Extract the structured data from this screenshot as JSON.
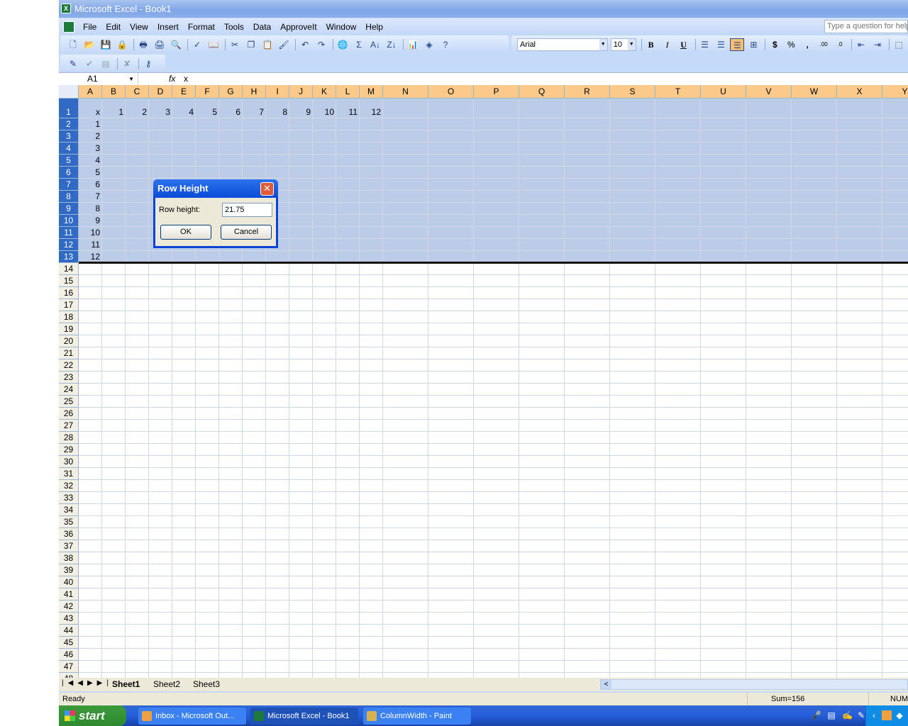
{
  "window": {
    "title": "Microsoft Excel - Book1"
  },
  "menu": [
    "File",
    "Edit",
    "View",
    "Insert",
    "Format",
    "Tools",
    "Data",
    "ApproveIt",
    "Window",
    "Help"
  ],
  "help_placeholder": "Type a question for help",
  "toolbar": {
    "standard_icons": [
      "new-icon",
      "open-icon",
      "save-icon",
      "permission-icon",
      "print-preview-icon",
      "print-icon",
      "preview-icon",
      "spelling-icon",
      "research-icon",
      "cut-icon",
      "copy-icon",
      "paste-icon",
      "format-painter-icon",
      "undo-icon",
      "redo-icon",
      "hyperlink-icon",
      "autosum-icon",
      "sort-ascending-icon",
      "sort-descending-icon",
      "chart-wizard-icon",
      "drawing-icon",
      "help-icon"
    ],
    "font": "Arial",
    "size": "10",
    "format_labels": {
      "bold": "B",
      "italic": "I",
      "underline": "U",
      "currency": "$",
      "percent": "%",
      "comma": ",",
      "inc_decimal": ".00",
      "dec_decimal": ".0"
    },
    "alignment_active": "align-right"
  },
  "formula_bar": {
    "name_box": "A1",
    "fx": "fx",
    "value": "x"
  },
  "sheet": {
    "columns": [
      "A",
      "B",
      "C",
      "D",
      "E",
      "F",
      "G",
      "H",
      "I",
      "J",
      "K",
      "L",
      "M",
      "N",
      "O",
      "P",
      "Q",
      "R",
      "S",
      "T",
      "U",
      "V",
      "W",
      "X",
      "Y"
    ],
    "row_count": 48,
    "selected_rows": [
      1,
      13
    ],
    "cells": {
      "A1": "x",
      "B1": "1",
      "C1": "2",
      "D1": "3",
      "E1": "4",
      "F1": "5",
      "G1": "6",
      "H1": "7",
      "I1": "8",
      "J1": "9",
      "K1": "10",
      "L1": "11",
      "M1": "12",
      "A2": "1",
      "A3": "2",
      "A4": "3",
      "A5": "4",
      "A6": "5",
      "A7": "6",
      "A8": "7",
      "A9": "8",
      "A10": "9",
      "A11": "10",
      "A12": "11",
      "A13": "12"
    }
  },
  "dialog": {
    "title": "Row Height",
    "label": "Row height:",
    "value": "21.75",
    "ok": "OK",
    "cancel": "Cancel"
  },
  "tabs": [
    "Sheet1",
    "Sheet2",
    "Sheet3"
  ],
  "active_tab": "Sheet1",
  "status": {
    "text": "Ready",
    "sum": "Sum=156",
    "num": "NUM"
  },
  "taskbar": {
    "start": "start",
    "items": [
      "Inbox - Microsoft Out...",
      "Microsoft Excel - Book1",
      "ColumnWidth - Paint"
    ],
    "active": 1
  }
}
